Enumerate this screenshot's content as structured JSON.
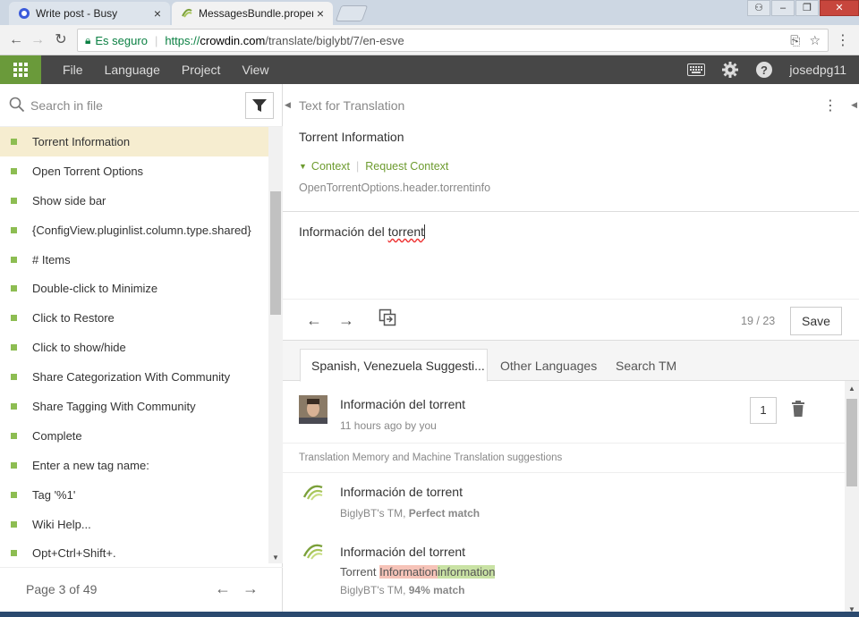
{
  "browser": {
    "tabs": [
      {
        "title": "Write post - Busy",
        "close": "×"
      },
      {
        "title": "MessagesBundle.properti",
        "close": "×"
      }
    ],
    "secure_label": "Es seguro",
    "url_scheme": "https://",
    "url_host": "crowdin.com",
    "url_path": "/translate/biglybt/7/en-esve"
  },
  "menubar": {
    "items": [
      "File",
      "Language",
      "Project",
      "View"
    ],
    "username": "josedpg11"
  },
  "left": {
    "search_placeholder": "Search in file",
    "strings": [
      "Torrent Information",
      "Open Torrent Options",
      "Show side bar",
      "{ConfigView.pluginlist.column.type.shared}",
      "# Items",
      "Double-click to Minimize",
      "Click to Restore",
      "Click to show/hide",
      "Share Categorization With Community",
      "Share Tagging With Community",
      "Complete",
      "Enter a new tag name:",
      "Tag '%1'",
      "Wiki Help...",
      "Opt+Ctrl+Shift+."
    ],
    "selected_index": 0,
    "page_label": "Page 3 of 49"
  },
  "editor": {
    "heading": "Text for Translation",
    "source": "Torrent Information",
    "context_label": "Context",
    "request_context_label": "Request Context",
    "key": "OpenTorrentOptions.header.torrentinfo",
    "translation_prefix": "Información del ",
    "translation_misspelled": "torrent",
    "counter": "19 / 23",
    "save_label": "Save"
  },
  "suggestions": {
    "tabs": [
      "Spanish, Venezuela Suggesti...",
      "Other Languages",
      "Search TM"
    ],
    "user": {
      "text": "Información del torrent",
      "meta": "11 hours ago by you",
      "votes": "1"
    },
    "tm_header": "Translation Memory and Machine Translation suggestions",
    "tm": [
      {
        "text": "Información de torrent",
        "meta_prefix": "BiglyBT's TM, ",
        "meta_match": "Perfect match"
      },
      {
        "text": "Información del torrent",
        "diff_prefix": "Torrent ",
        "diff_removed": "Information",
        "diff_added": "information",
        "meta_prefix": "BiglyBT's TM, ",
        "meta_match": "94% match"
      }
    ]
  },
  "colors": {
    "accent_green": "#6d9b2f",
    "menubar_bg": "#474747",
    "selected_row": "#f6edd0"
  }
}
